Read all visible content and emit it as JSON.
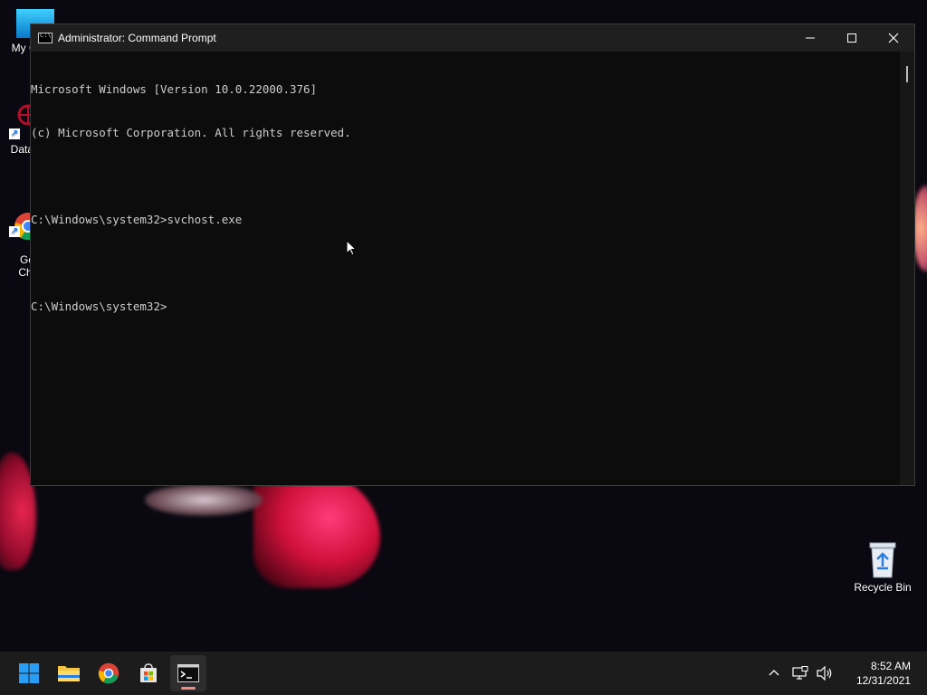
{
  "desktop": {
    "icons": [
      {
        "label": "My Co",
        "name": "desktop-icon-my-computer"
      },
      {
        "label": "DataW",
        "name": "desktop-icon-dataw"
      },
      {
        "label": "Go\nChr",
        "name": "desktop-icon-google-chrome"
      }
    ],
    "recycle_bin_label": "Recycle Bin"
  },
  "cmd_window": {
    "title": "Administrator: Command Prompt",
    "lines": [
      "Microsoft Windows [Version 10.0.22000.376]",
      "(c) Microsoft Corporation. All rights reserved.",
      "",
      "C:\\Windows\\system32>svchost.exe",
      "",
      "C:\\Windows\\system32>"
    ]
  },
  "taskbar": {
    "apps": [
      {
        "name": "start-button-windows-icon",
        "icon": "windows-logo"
      },
      {
        "name": "taskbar-file-explorer-icon",
        "icon": "folder"
      },
      {
        "name": "taskbar-chrome-icon",
        "icon": "chrome"
      },
      {
        "name": "taskbar-store-icon",
        "icon": "store"
      },
      {
        "name": "taskbar-command-prompt-icon",
        "icon": "terminal",
        "active": true
      }
    ],
    "clock": {
      "time": "8:52 AM",
      "date": "12/31/2021"
    }
  },
  "colors": {
    "console_bg": "#0c0c0c",
    "console_text": "#cccccc",
    "taskbar_bg": "#1c1c1c",
    "active_indicator": "#f28b82"
  }
}
